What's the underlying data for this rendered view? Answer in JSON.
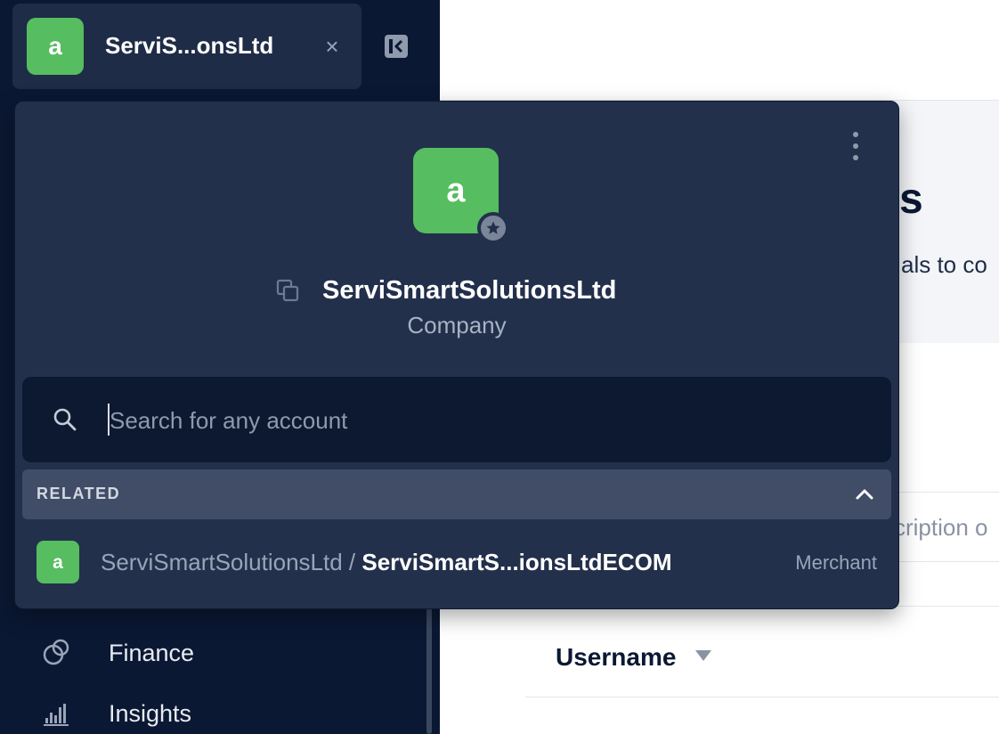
{
  "account": {
    "name_short": "ServiS...onsLtd",
    "name_full": "ServiSmartSolutionsLtd",
    "type": "Company",
    "logo_letter": "a"
  },
  "sidebar": {
    "close_symbol": "×",
    "nav_items": [
      {
        "label": "Finance",
        "icon": "finance-icon"
      },
      {
        "label": "Insights",
        "icon": "insights-icon"
      }
    ]
  },
  "search": {
    "placeholder": "Search for any account"
  },
  "related": {
    "header": "RELATED",
    "items": [
      {
        "parent": "ServiSmartSolutionsLtd",
        "separator": " / ",
        "name": "ServiSmartS...ionsLtdECOM",
        "type": "Merchant",
        "logo_letter": "a"
      }
    ]
  },
  "main": {
    "title_fragment": "s",
    "subtitle_fragment": "als to co",
    "description_placeholder_fragment": "cription o",
    "table": {
      "columns": [
        "Username"
      ]
    }
  },
  "colors": {
    "sidebar_bg": "#0b1833",
    "popover_bg": "#23304b",
    "brand_green": "#56bd60",
    "search_bg": "#0d1930",
    "related_header_bg": "#414d67"
  }
}
